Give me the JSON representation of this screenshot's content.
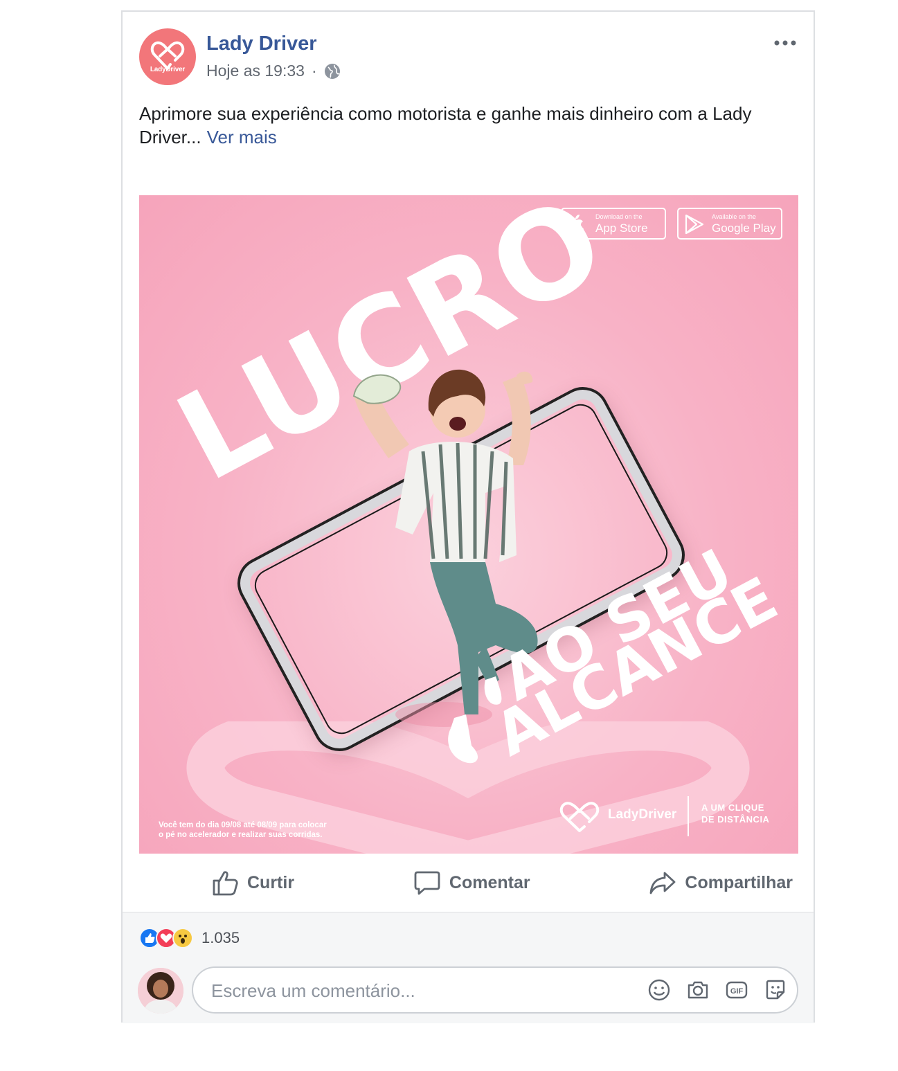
{
  "post": {
    "page_name": "Lady Driver",
    "logo_text": "LadyDriver",
    "timestamp": "Hoje as 19:33",
    "separator": "·",
    "text": "Aprimore sua experiência como motorista e ganhe mais dinheiro com a Lady Driver...",
    "see_more": "Ver mais"
  },
  "ad": {
    "appstore_small": "Download on the",
    "appstore_big": "App Store",
    "googleplay_small": "Available on the",
    "googleplay_big": "Google Play",
    "headline_1": "LUCRO",
    "headline_2": "AO SEU",
    "headline_3": "ALCANCE",
    "footer_line_1": "Você tem do dia 09/08 até 08/09 para colocar",
    "footer_line_2": "o pé no acelerador e realizar suas corridas.",
    "brand": "LadyDriver",
    "tagline_1": "A UM CLIQUE",
    "tagline_2": "DE DISTÂNCIA"
  },
  "actions": {
    "like": "Curtir",
    "comment": "Comentar",
    "share": "Compartilhar"
  },
  "reactions": {
    "count": "1.035"
  },
  "comment": {
    "placeholder": "Escreva um comentário..."
  },
  "colors": {
    "brand_pink": "#f2767a",
    "link_blue": "#385898",
    "ad_pink": "#f8b2c6"
  }
}
